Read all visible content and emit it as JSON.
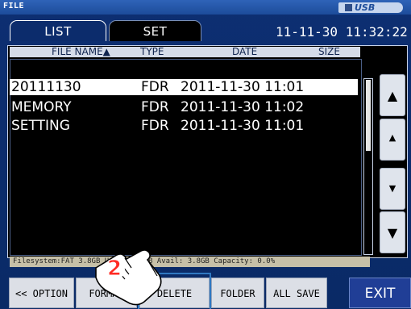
{
  "title_bar": {
    "title": "FILE",
    "device": "USB"
  },
  "tabs": [
    {
      "label": "LIST"
    },
    {
      "label": "SET"
    }
  ],
  "clock": "11-11-30 11:32:22",
  "columns": {
    "name": "FILE NAME▲",
    "type": "TYPE",
    "date": "DATE",
    "size": "SIZE"
  },
  "files": [
    {
      "name": "20111130",
      "type": "FDR",
      "date": "2011-11-30 11:01",
      "size": ""
    },
    {
      "name": "MEMORY",
      "type": "FDR",
      "date": "2011-11-30 11:02",
      "size": ""
    },
    {
      "name": "SETTING",
      "type": "FDR",
      "date": "2011-11-30 11:01",
      "size": ""
    }
  ],
  "selected_row_index": 0,
  "scroll_buttons": [
    {
      "icon": "page-up-icon",
      "glyph": "▲"
    },
    {
      "icon": "up-icon",
      "glyph": "▲"
    },
    {
      "icon": "down-icon",
      "glyph": "▼"
    },
    {
      "icon": "page-down-icon",
      "glyph": "▼"
    }
  ],
  "status": "Filesystem:FAT  3.8GB Used: 392KB Avail: 3.8GB Capacity: 0.0%",
  "buttons": {
    "option": "<< OPTION",
    "format": "FORMAT",
    "delete": "DELETE",
    "folder": "FOLDER",
    "all_save": "ALL SAVE",
    "exit": "EXIT"
  },
  "callout": {
    "number": "2"
  },
  "colors": {
    "background": "#0a2f6e",
    "exit_button": "#203e96",
    "highlight": "#2f78c2",
    "callout": "#ff2b24"
  }
}
